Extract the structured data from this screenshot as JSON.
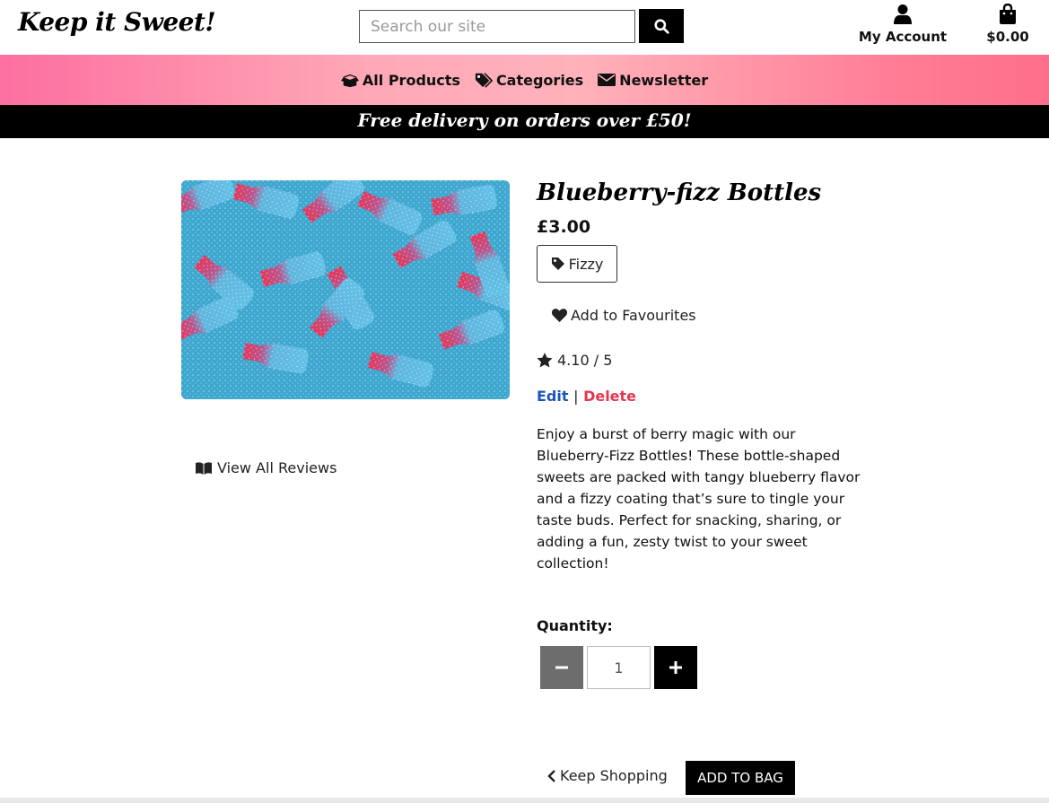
{
  "header": {
    "logo": "Keep it Sweet!",
    "search_placeholder": "Search our site",
    "account_label": "My Account",
    "bag_total": "$0.00"
  },
  "nav": {
    "items": [
      {
        "label": "All Products",
        "icon": "box-open-icon"
      },
      {
        "label": "Categories",
        "icon": "tags-icon"
      },
      {
        "label": "Newsletter",
        "icon": "envelope-icon"
      }
    ]
  },
  "banner": "Free delivery on orders over £50!",
  "product": {
    "title": "Blueberry-fizz Bottles",
    "price": "£3.00",
    "tag": "Fizzy",
    "favourite_label": "Add to Favourites",
    "rating": "4.10 / 5",
    "edit_label": "Edit",
    "separator": "|",
    "delete_label": "Delete",
    "description": "Enjoy a burst of berry magic with our Blueberry-Fizz Bottles! These bottle-shaped sweets are packed with tangy blueberry flavor and a fizzy coating that’s sure to tingle your taste buds. Perfect for snacking, sharing, or adding a fun, zesty twist to your sweet collection!",
    "view_reviews_label": "View All Reviews"
  },
  "quantity": {
    "label": "Quantity:",
    "value": "1"
  },
  "actions": {
    "keep_shopping": "Keep Shopping",
    "add_to_bag": "ADD TO BAG"
  },
  "colors": {
    "nav_gradient_start": "#fc6fa0",
    "nav_gradient_end": "#fe6f8b",
    "edit_link": "#1a56b8",
    "delete_link": "#e0394f",
    "qty_minus": "#6d6d6d"
  }
}
